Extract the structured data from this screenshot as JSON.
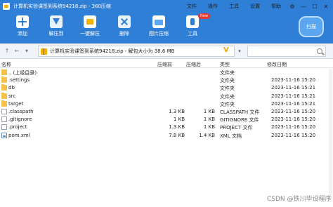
{
  "window": {
    "title": "计算机实验课签到系统94218.zip - 360压缩",
    "menus": [
      "文件",
      "操作",
      "工具",
      "设置",
      "帮助"
    ],
    "controls": [
      "⚙",
      "—",
      "☐",
      "✕"
    ]
  },
  "toolbar": {
    "items": [
      {
        "label": "添加",
        "icon": "add-icon"
      },
      {
        "label": "解压到",
        "icon": "extract-icon"
      },
      {
        "label": "一键解压",
        "icon": "onekey-extract-icon"
      },
      {
        "label": "删除",
        "icon": "delete-icon"
      },
      {
        "label": "图片压缩",
        "icon": "image-compress-icon"
      },
      {
        "label": "工具",
        "icon": "tools-icon"
      }
    ],
    "new_badge": "New",
    "scan_label": "扫描"
  },
  "address": {
    "path": "计算机实验课签到系统94218.zip - 解包大小为 38.6 MB",
    "v_glyph": "V",
    "dropdown": "▾"
  },
  "columns": {
    "name": "名称",
    "packed": "压缩前",
    "size": "压缩后",
    "type": "类型",
    "modified": "修改日期"
  },
  "rows": [
    {
      "name": ".. (上级目录)",
      "icon": "up-folder",
      "size": "",
      "packed": "",
      "type": "文件夹",
      "modified": ""
    },
    {
      "name": ".settings",
      "icon": "folder",
      "size": "",
      "packed": "",
      "type": "文件夹",
      "modified": "2023-11-16 15:20"
    },
    {
      "name": "db",
      "icon": "folder",
      "size": "",
      "packed": "",
      "type": "文件夹",
      "modified": "2023-11-16 15:21"
    },
    {
      "name": "src",
      "icon": "folder",
      "size": "",
      "packed": "",
      "type": "文件夹",
      "modified": "2023-11-16 15:21"
    },
    {
      "name": "target",
      "icon": "folder",
      "size": "",
      "packed": "",
      "type": "文件夹",
      "modified": "2023-11-16 15:21"
    },
    {
      "name": ".classpath",
      "icon": "file",
      "size": "1.3 KB",
      "packed": "1 KB",
      "type": "CLASSPATH 文件",
      "modified": "2023-11-16 15:20"
    },
    {
      "name": ".gitignore",
      "icon": "file",
      "size": "1 KB",
      "packed": "1 KB",
      "type": "GITIGNORE 文件",
      "modified": "2023-11-16 15:20"
    },
    {
      "name": ".project",
      "icon": "file",
      "size": "1.3 KB",
      "packed": "1 KB",
      "type": "PROJECT 文件",
      "modified": "2023-11-16 15:20"
    },
    {
      "name": "pom.xml",
      "icon": "xml-file",
      "size": "7.8 KB",
      "packed": "1.4 KB",
      "type": "XML 文档",
      "modified": "2023-11-16 15:20"
    }
  ],
  "watermark": "CSDN @铁川毕设程序"
}
